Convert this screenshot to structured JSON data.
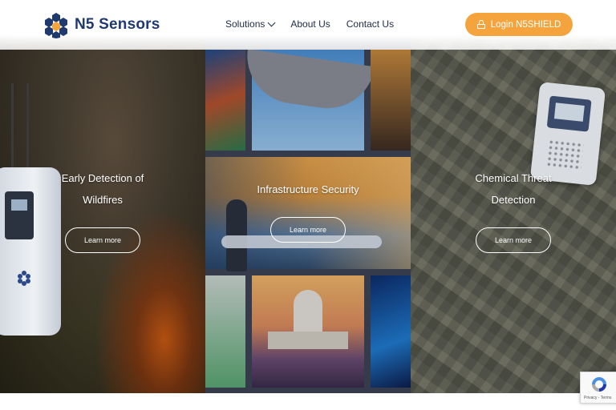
{
  "header": {
    "brand": "N5 Sensors",
    "nav": [
      {
        "label": "Solutions",
        "has_dropdown": true
      },
      {
        "label": "About Us",
        "has_dropdown": false
      },
      {
        "label": "Contact Us",
        "has_dropdown": false
      }
    ],
    "login_label": "Login N5SHIELD",
    "accent_color": "#f5a43d",
    "brand_color": "#1f3a6e"
  },
  "panels": [
    {
      "title": "Early Detection of Wildfires",
      "button": "Learn more"
    },
    {
      "title": "Infrastructure Security",
      "button": "Learn more"
    },
    {
      "title": "Chemical Threat Detection",
      "button": "Learn more"
    }
  ],
  "recaptcha": {
    "footer": "Privacy - Terms"
  },
  "icons": [
    "hexagon-logo-icon",
    "chevron-down-icon",
    "lock-icon",
    "recaptcha-icon"
  ]
}
